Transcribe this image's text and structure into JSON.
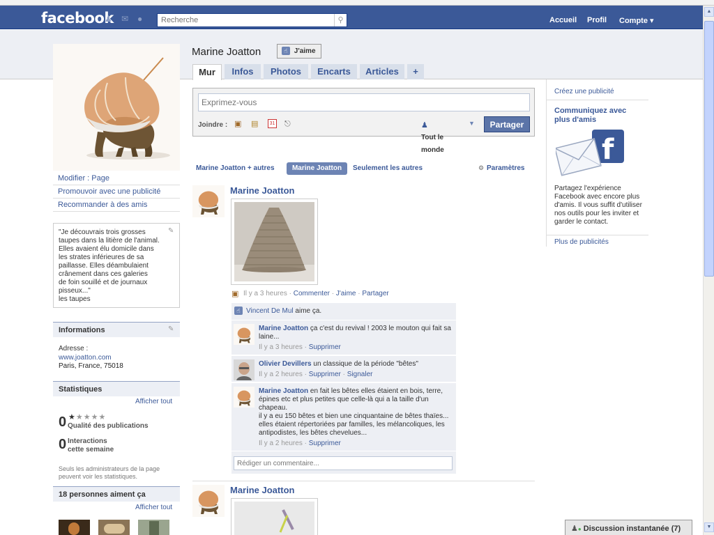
{
  "header": {
    "logo": "facebook",
    "search_placeholder": "Recherche",
    "nav": [
      "Accueil",
      "Profil",
      "Compte ▾"
    ]
  },
  "left": {
    "links": [
      "Modifier : Page",
      "Promouvoir avec une publicité",
      "Recommander à des amis"
    ],
    "quote_lines": [
      "\"Je découvrais trois grosses",
      "taupes dans la litière de l'animal.",
      "Elles avaient élu domicile dans",
      "les strates inférieures de sa",
      "paillasse. Elles déambulaient",
      "crânement dans ces galeries",
      "de foin souillé et de journaux",
      "pisseux...\"",
      "les taupes"
    ],
    "info_title": "Informations",
    "address_label": "Adresse :",
    "website": "www.joatton.com",
    "address": "Paris, France, 75018",
    "stats_title": "Statistiques",
    "show_all": "Afficher tout",
    "quality_value": "0",
    "quality_label": "Qualité des publications",
    "interactions_value": "0",
    "interactions_label1": "Interactions",
    "interactions_label2": "cette semaine",
    "admin_note1": "Seuls les administrateurs de la page",
    "admin_note2": "peuvent voir les statistiques.",
    "fans_title": "18 personnes aiment ça",
    "fans_show_all": "Afficher tout"
  },
  "page": {
    "name": "Marine Joatton",
    "like_button": "J'aime",
    "tabs": [
      "Mur",
      "Infos",
      "Photos",
      "Encarts",
      "Articles",
      "+"
    ]
  },
  "composer": {
    "placeholder": "Exprimez-vous",
    "attach_label": "Joindre :",
    "calendar_day": "31",
    "audience1": "Tout le",
    "audience2": "monde",
    "share": "Partager"
  },
  "filters": {
    "f1": "Marine Joatton + autres",
    "f2": "Marine Joatton",
    "f3": "Seulement les autres",
    "settings": "Paramètres"
  },
  "post1": {
    "author": "Marine Joatton",
    "time": "Il y a 3 heures",
    "comment": "Commenter",
    "like": "J'aime",
    "share": "Partager",
    "sep": "·",
    "liker": "Vincent De Mul",
    "likes_suffix": "aime ça.",
    "comments": [
      {
        "name": "Marine Joatton",
        "text": "ça c'est du revival ! 2003 le mouton qui fait sa laine...",
        "time": "Il y a 3 heures",
        "action1": "Supprimer",
        "action2": ""
      },
      {
        "name": "Olivier Devillers",
        "text": "un classique de la période \"bêtes\"",
        "time": "Il y a 2 heures",
        "action1": "Supprimer",
        "action2": "Signaler"
      },
      {
        "name": "Marine Joatton",
        "text": "en fait les bêtes elles étaient en bois, terre, épines etc et plus petites que celle-là qui a la taille d'un chapeau.",
        "text2": "il y a eu 150 bêtes et bien une cinquantaine de bêtes thaïes... elles étaient répertoriées par familles, les mélancoliques, les antipodistes, les bêtes chevelues...",
        "time": "Il y a 2 heures",
        "action1": "Supprimer",
        "action2": ""
      }
    ],
    "comment_placeholder": "Rédiger un commentaire..."
  },
  "post2": {
    "author": "Marine Joatton"
  },
  "right": {
    "create_ad": "Créez une publicité",
    "ad_title": "Communiquez avec plus d'amis",
    "ad_text": "Partagez l'expérience Facebook avec encore plus d'amis. Il vous suffit d'utiliser nos outils pour les inviter et garder le contact.",
    "more_ads": "Plus de publicités"
  },
  "chat": {
    "label": "Discussion instantanée (7)"
  }
}
